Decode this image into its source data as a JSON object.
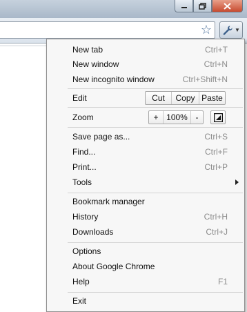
{
  "window": {
    "minimize_icon": "minimize-icon",
    "restore_icon": "restore-icon",
    "close_icon": "close-icon"
  },
  "toolbar": {
    "star_icon": "bookmark-star-icon",
    "wrench_icon": "wrench-icon"
  },
  "menu": {
    "new_tab": {
      "label": "New tab",
      "shortcut": "Ctrl+T"
    },
    "new_window": {
      "label": "New window",
      "shortcut": "Ctrl+N"
    },
    "new_incognito": {
      "label": "New incognito window",
      "shortcut": "Ctrl+Shift+N"
    },
    "edit": {
      "label": "Edit",
      "cut": "Cut",
      "copy": "Copy",
      "paste": "Paste"
    },
    "zoom": {
      "label": "Zoom",
      "plus": "+",
      "level": "100%",
      "minus": "-"
    },
    "save_page": {
      "label": "Save page as...",
      "shortcut": "Ctrl+S"
    },
    "find": {
      "label": "Find...",
      "shortcut": "Ctrl+F"
    },
    "print": {
      "label": "Print...",
      "shortcut": "Ctrl+P"
    },
    "tools": {
      "label": "Tools"
    },
    "bookmark_manager": {
      "label": "Bookmark manager"
    },
    "history": {
      "label": "History",
      "shortcut": "Ctrl+H"
    },
    "downloads": {
      "label": "Downloads",
      "shortcut": "Ctrl+J"
    },
    "options": {
      "label": "Options"
    },
    "about": {
      "label": "About Google Chrome"
    },
    "help": {
      "label": "Help",
      "shortcut": "F1"
    },
    "exit": {
      "label": "Exit"
    }
  }
}
